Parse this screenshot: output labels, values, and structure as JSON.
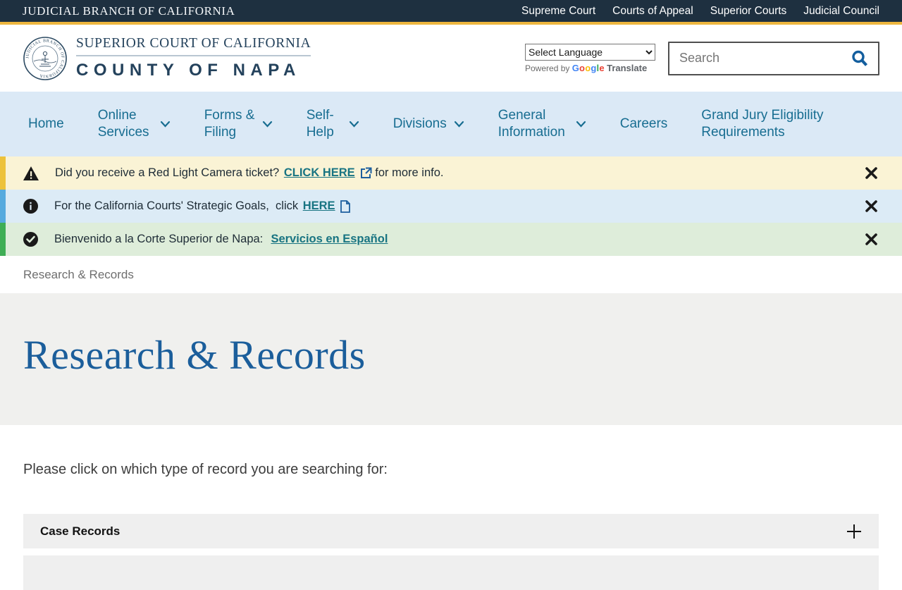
{
  "utility_bar": {
    "title": "JUDICIAL BRANCH OF CALIFORNIA",
    "links": [
      {
        "label": "Supreme Court"
      },
      {
        "label": "Courts of Appeal"
      },
      {
        "label": "Superior Courts"
      },
      {
        "label": "Judicial Council"
      }
    ]
  },
  "header": {
    "seal_text": "JUDICIAL BRANCH OF CALIFORNIA",
    "site_name_line1": "SUPERIOR COURT OF CALIFORNIA",
    "site_name_line2": "COUNTY OF NAPA",
    "language": {
      "selected": "Select Language",
      "powered_by": "Powered by",
      "google": "Google",
      "google_colors": [
        "#4285F4",
        "#EA4335",
        "#FBBC05",
        "#4285F4",
        "#34A853",
        "#EA4335"
      ],
      "translate": "Translate"
    },
    "search": {
      "placeholder": "Search"
    }
  },
  "nav": {
    "items": [
      {
        "label": "Home",
        "has_dropdown": false
      },
      {
        "label": "Online Services",
        "has_dropdown": true
      },
      {
        "label": "Forms & Filing",
        "has_dropdown": true
      },
      {
        "label": "Self-Help",
        "has_dropdown": true
      },
      {
        "label": "Divisions",
        "has_dropdown": true
      },
      {
        "label": "General Information",
        "has_dropdown": true
      },
      {
        "label": "Careers",
        "has_dropdown": false
      },
      {
        "label": "Grand Jury Eligibility Requirements",
        "has_dropdown": false
      }
    ]
  },
  "alerts": [
    {
      "type": "warning",
      "icon": "warning-triangle",
      "text_before": "Did you receive a Red Light Camera ticket? ",
      "link_label": "CLICK HERE",
      "link_icon": "external-link",
      "text_after": " for more info.",
      "close_icon": "close"
    },
    {
      "type": "info",
      "icon": "info-circle",
      "text_before": "For the California Courts' Strategic Goals,  click ",
      "link_label": "HERE",
      "link_icon": "document",
      "text_after": "",
      "close_icon": "close"
    },
    {
      "type": "success",
      "icon": "check-circle",
      "text_before": "Bienvenido a la Corte Superior de Napa:  ",
      "link_label": "Servicios en Español",
      "link_icon": "",
      "text_after": "",
      "close_icon": "close"
    }
  ],
  "breadcrumb": {
    "current": "Research & Records"
  },
  "page": {
    "title": "Research & Records",
    "intro": "Please click on which type of record you are searching for:",
    "accordions": [
      {
        "label": "Case Records",
        "expand_symbol": "+"
      }
    ]
  },
  "icons": {
    "search": "magnifying-glass",
    "chevron": "chevron-down",
    "close": "✕",
    "plus": "+",
    "warning": "⚠",
    "info": "ℹ",
    "success": "✔",
    "external_link": "↗",
    "document": "📄"
  },
  "colors": {
    "utility_bar_bg": "#1e3040",
    "gold_accent": "#edb63e",
    "brand_navy": "#24425c",
    "nav_bg": "#dbe9f6",
    "nav_link": "#176d91",
    "alert_warning_bg": "#faf3d5",
    "alert_warning_border": "#edc23b",
    "alert_info_bg": "#dcebf6",
    "alert_info_border": "#56aade",
    "alert_success_bg": "#deedda",
    "alert_success_border": "#3fae55",
    "link_teal": "#187482",
    "title_blue": "#1b5e9b",
    "title_band_bg": "#f0f0ee",
    "accordion_bg": "#efefef",
    "search_icon_blue": "#135e9e"
  }
}
